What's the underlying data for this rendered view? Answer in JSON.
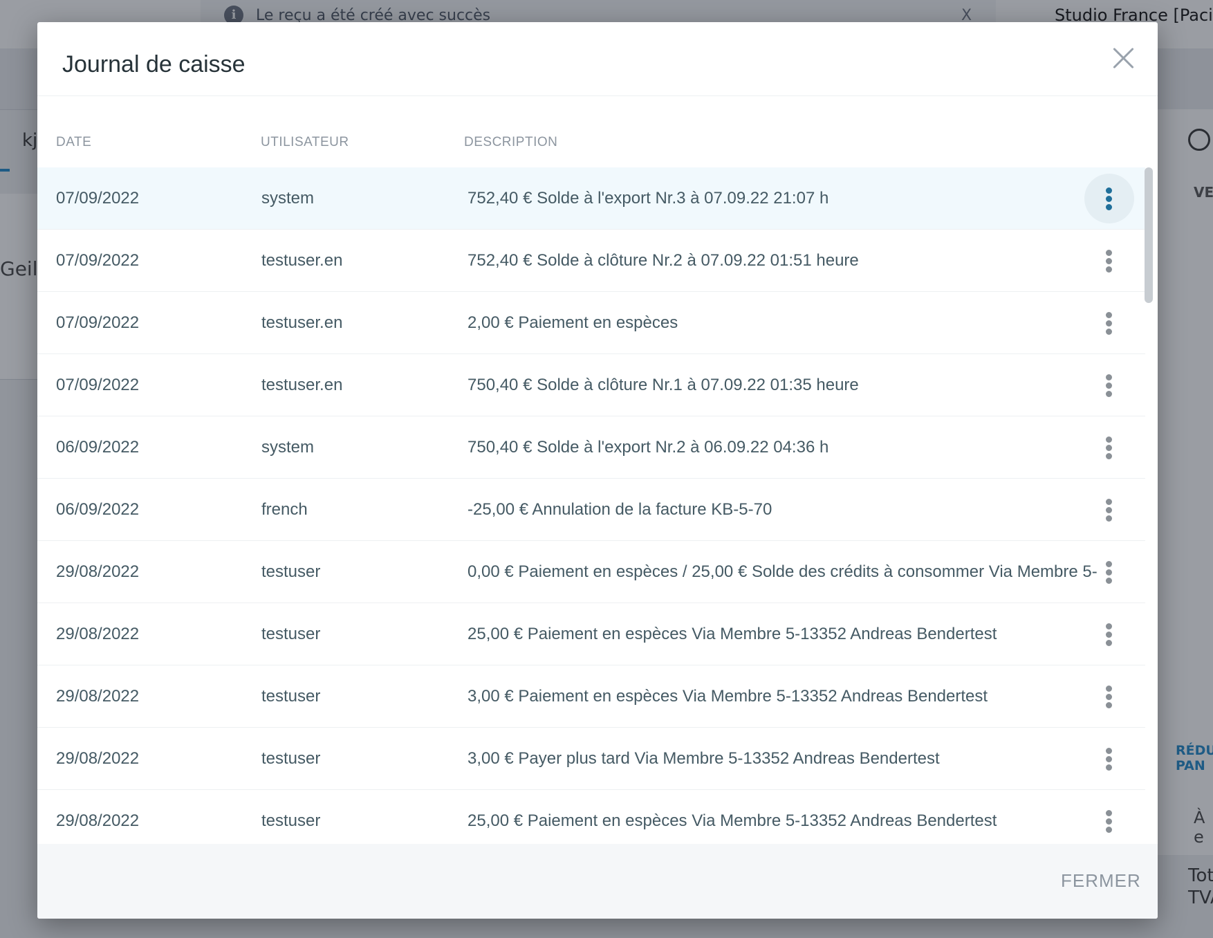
{
  "background": {
    "notice_text": "Le reçu a été créé avec succès",
    "notice_close": "X",
    "studio": "Studio France [Pacific/",
    "tab_label": "kj",
    "card_text": "Geile",
    "right_col_header": "VEI",
    "reduction_label_1": "RÉDU",
    "reduction_label_2": "PAN",
    "due_label": "À e",
    "total_label": "Tot",
    "vat_label": "TVA"
  },
  "modal": {
    "title": "Journal de caisse",
    "columns": {
      "date": "DATE",
      "user": "UTILISATEUR",
      "description": "DESCRIPTION"
    },
    "rows": [
      {
        "date": "07/09/2022",
        "user": "system",
        "description": "752,40 € Solde à l'export Nr.3 à 07.09.22 21:07 h"
      },
      {
        "date": "07/09/2022",
        "user": "testuser.en",
        "description": "752,40 € Solde à clôture Nr.2 à 07.09.22 01:51 heure"
      },
      {
        "date": "07/09/2022",
        "user": "testuser.en",
        "description": "2,00 € Paiement en espèces"
      },
      {
        "date": "07/09/2022",
        "user": "testuser.en",
        "description": "750,40 € Solde à clôture Nr.1 à 07.09.22 01:35 heure"
      },
      {
        "date": "06/09/2022",
        "user": "system",
        "description": "750,40 € Solde à l'export Nr.2 à 06.09.22 04:36 h"
      },
      {
        "date": "06/09/2022",
        "user": "french",
        "description": "-25,00 € Annulation de la facture KB-5-70"
      },
      {
        "date": "29/08/2022",
        "user": "testuser",
        "description": "0,00 € Paiement en espèces / 25,00 € Solde des crédits à consommer Via Membre 5-"
      },
      {
        "date": "29/08/2022",
        "user": "testuser",
        "description": "25,00 € Paiement en espèces Via Membre 5-13352 Andreas Bendertest"
      },
      {
        "date": "29/08/2022",
        "user": "testuser",
        "description": "3,00 € Paiement en espèces Via Membre 5-13352 Andreas Bendertest"
      },
      {
        "date": "29/08/2022",
        "user": "testuser",
        "description": "3,00 € Payer plus tard Via Membre 5-13352 Andreas Bendertest"
      },
      {
        "date": "29/08/2022",
        "user": "testuser",
        "description": "25,00 € Paiement en espèces Via Membre 5-13352 Andreas Bendertest"
      }
    ],
    "close_button": "FERMER"
  },
  "colors": {
    "accent": "#1f6f9a",
    "active_row": "#f1f9fd",
    "text": "#455a64"
  }
}
